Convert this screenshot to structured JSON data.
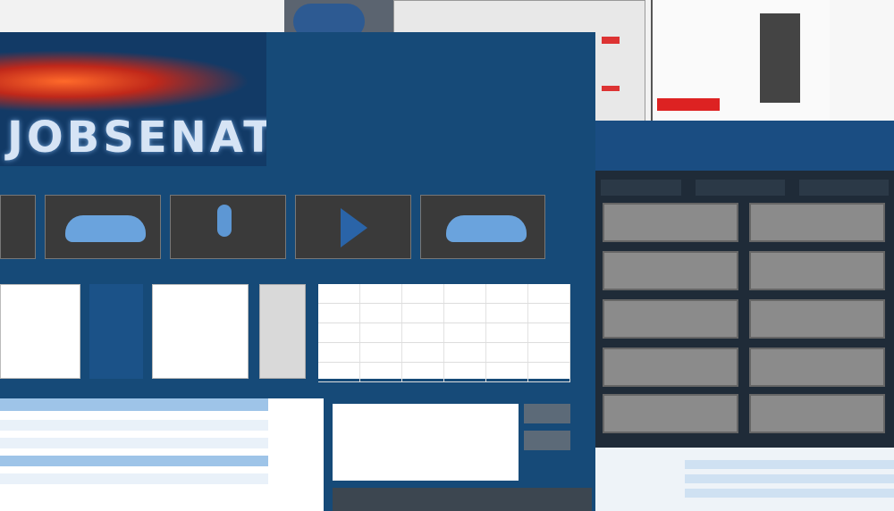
{
  "banner": {
    "logo_text": "JOBSENATV"
  },
  "sections": {
    "weather_title": "",
    "location_title": "",
    "forward_title": "",
    "cloud_title": "",
    "table_title": ""
  },
  "tiles": [
    {
      "name": "weather",
      "icon": "cloud-icon"
    },
    {
      "name": "location",
      "icon": "map-pin-icon"
    },
    {
      "name": "forward",
      "icon": "arrow-right-icon"
    },
    {
      "name": "sky",
      "icon": "cloud-icon"
    }
  ],
  "right_panel": {
    "tabs": [
      "",
      "",
      ""
    ],
    "buttons": [
      "",
      "",
      "",
      "",
      "",
      "",
      "",
      "",
      "",
      ""
    ]
  },
  "colors": {
    "main_blue": "#164a78",
    "accent_red": "#d33333",
    "panel_dark": "#1f2b38"
  }
}
